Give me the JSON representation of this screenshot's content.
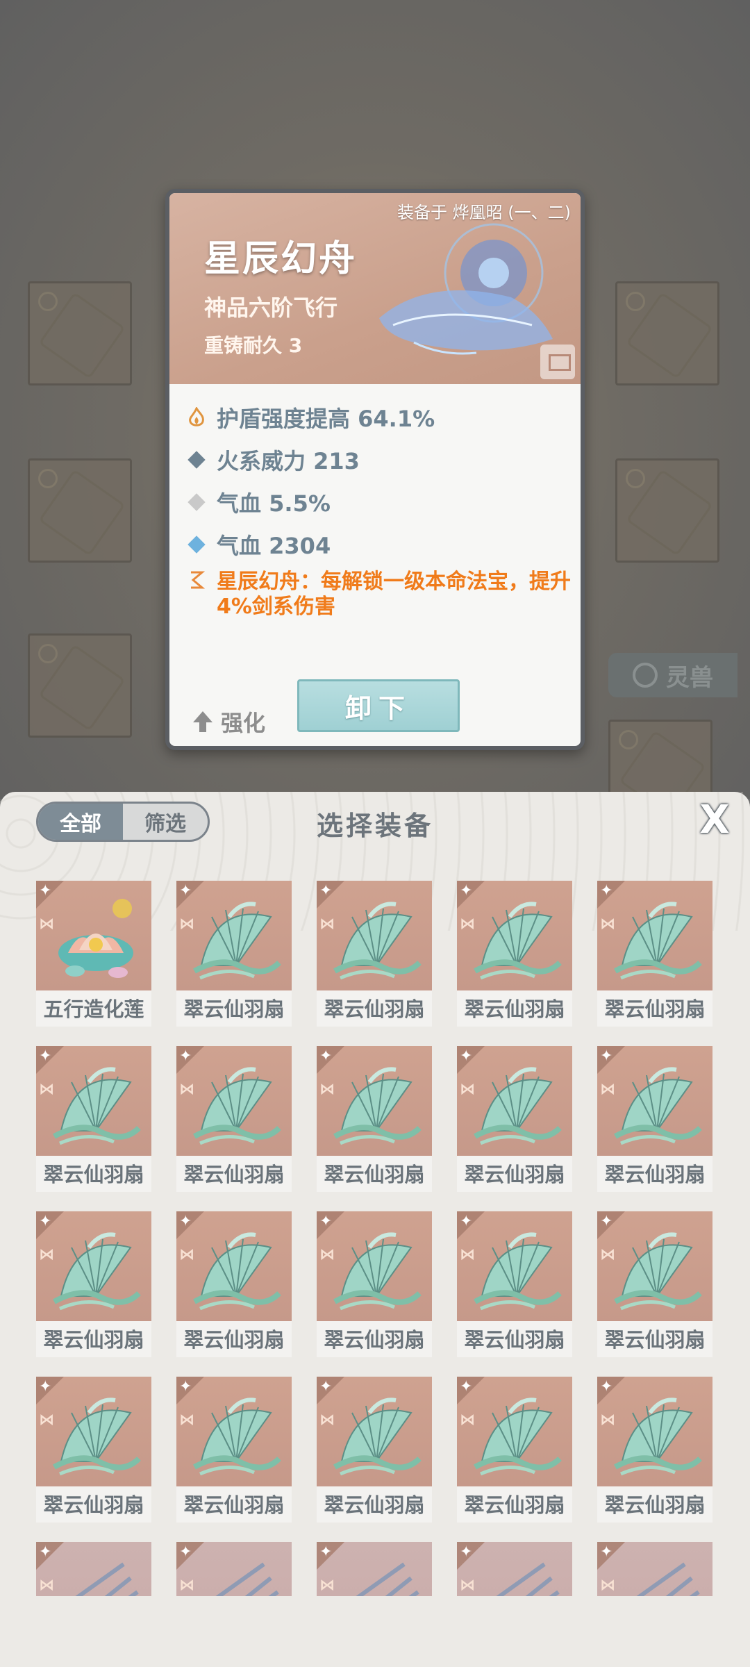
{
  "detail": {
    "equipped_on": "装备于 烨凰昭 (一、二)",
    "name": "星辰幻舟",
    "grade": "神品六阶飞行",
    "reforge": "重铸耐久 3",
    "stats": [
      {
        "text": "护盾强度提高 64.1%",
        "bullet_color": "#e0953f",
        "bullet": "flame-icon"
      },
      {
        "text": "火系威力 213",
        "bullet_color": "#6e8392",
        "bullet": "diamond-icon"
      },
      {
        "text": "气血 5.5%",
        "bullet_color": "#c9c9c9",
        "bullet": "diamond-icon"
      },
      {
        "text": "气血 2304",
        "bullet_color": "#6eb2de",
        "bullet": "diamond-icon"
      }
    ],
    "unique_effect": "星辰幻舟：每解锁一级本命法宝，提升4%剑系伤害",
    "enhance_label": "强化",
    "unequip_label": "卸下"
  },
  "background": {
    "lingshou_label": "灵兽"
  },
  "panel": {
    "tab_all": "全部",
    "tab_filter": "筛选",
    "title": "选择装备",
    "close_label": "X",
    "items": [
      {
        "name": "五行造化莲"
      },
      {
        "name": "翠云仙羽扇"
      },
      {
        "name": "翠云仙羽扇"
      },
      {
        "name": "翠云仙羽扇"
      },
      {
        "name": "翠云仙羽扇"
      },
      {
        "name": "翠云仙羽扇"
      },
      {
        "name": "翠云仙羽扇"
      },
      {
        "name": "翠云仙羽扇"
      },
      {
        "name": "翠云仙羽扇"
      },
      {
        "name": "翠云仙羽扇"
      },
      {
        "name": "翠云仙羽扇"
      },
      {
        "name": "翠云仙羽扇"
      },
      {
        "name": "翠云仙羽扇"
      },
      {
        "name": "翠云仙羽扇"
      },
      {
        "name": "翠云仙羽扇"
      },
      {
        "name": "翠云仙羽扇"
      },
      {
        "name": "翠云仙羽扇"
      },
      {
        "name": "翠云仙羽扇"
      },
      {
        "name": "翠云仙羽扇"
      },
      {
        "name": "翠云仙羽扇"
      }
    ]
  },
  "colors": {
    "stat_text": "#6e8392",
    "unique_text": "#f07b1a",
    "button_teal": "#9fd0d3"
  }
}
